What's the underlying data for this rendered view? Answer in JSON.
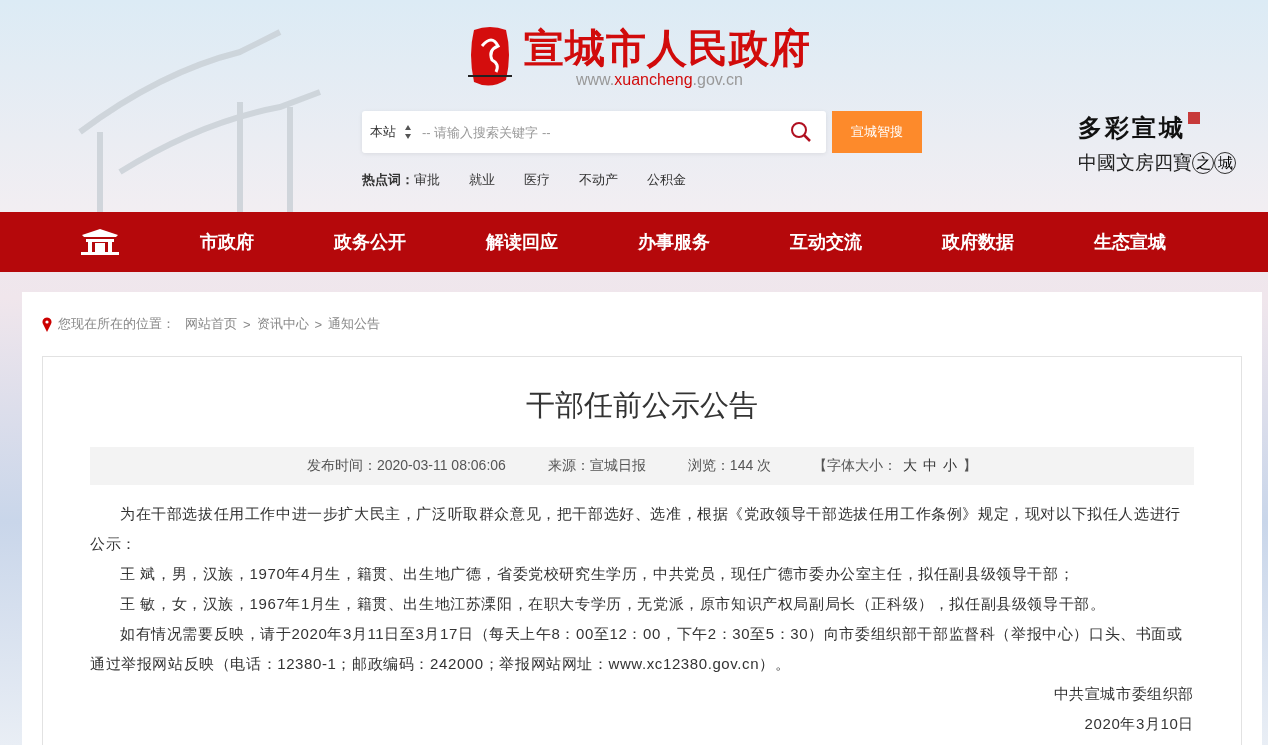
{
  "header": {
    "site_name": "宣城市人民政府",
    "url_prefix": "www.",
    "url_highlight": "xuancheng",
    "url_suffix": ".gov.cn",
    "slogan": "多彩宣城",
    "slogan_sub": "中國文房四寶",
    "slogan_circled": [
      "之",
      "城"
    ]
  },
  "search": {
    "scope": "本站",
    "placeholder": "-- 请输入搜索关键字 --",
    "button": "宣城智搜"
  },
  "hot_words": {
    "label": "热点词：",
    "items": [
      "审批",
      "就业",
      "医疗",
      "不动产",
      "公积金"
    ]
  },
  "nav": [
    "市政府",
    "政务公开",
    "解读回应",
    "办事服务",
    "互动交流",
    "政府数据",
    "生态宣城"
  ],
  "breadcrumb": {
    "label": "您现在所在的位置：",
    "items": [
      "网站首页",
      "资讯中心",
      "通知公告"
    ],
    "separator": ">"
  },
  "article": {
    "title": "干部任前公示公告",
    "meta": {
      "published": "发布时间：2020-03-11 08:06:06",
      "source": "来源：宣城日报",
      "views": "浏览：144 次",
      "font_size_label": "【字体大小：",
      "font_sizes": [
        "大",
        "中",
        "小"
      ],
      "font_size_end": "】"
    },
    "paragraphs": [
      "为在干部选拔任用工作中进一步扩大民主，广泛听取群众意见，把干部选好、选准，根据《党政领导干部选拔任用工作条例》规定，现对以下拟任人选进行公示：",
      "王 斌，男，汉族，1970年4月生，籍贯、出生地广德，省委党校研究生学历，中共党员，现任广德市委办公室主任，拟任副县级领导干部；",
      "王 敏，女，汉族，1967年1月生，籍贯、出生地江苏溧阳，在职大专学历，无党派，原市知识产权局副局长（正科级），拟任副县级领导干部。",
      "如有情况需要反映，请于2020年3月11日至3月17日（每天上午8：00至12：00，下午2：30至5：30）向市委组织部干部监督科（举报中心）口头、书面或通过举报网站反映（电话：12380-1；邮政编码：242000；举报网站网址：www.xc12380.gov.cn）。"
    ],
    "signature": "中共宣城市委组织部",
    "date": "2020年3月10日"
  }
}
